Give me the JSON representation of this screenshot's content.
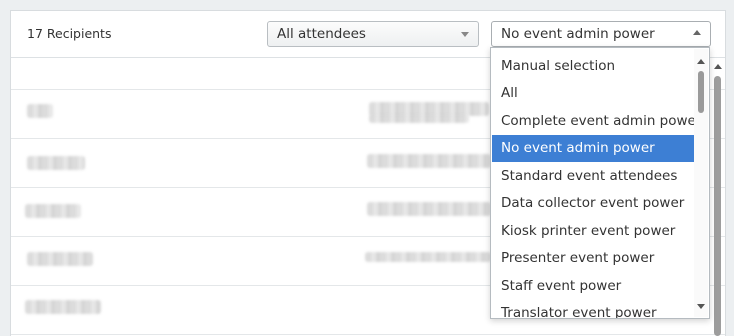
{
  "header": {
    "recipients_count": "17 Recipients"
  },
  "filters": {
    "attendees_select": "All attendees",
    "power_select": "No event admin power"
  },
  "power_dropdown": {
    "options": [
      "Manual selection",
      "All",
      "Complete event admin power",
      "No event admin power",
      "Standard event attendees",
      "Data collector event power",
      "Kiosk printer event power",
      "Presenter event power",
      "Staff event power",
      "Translator event power"
    ],
    "selected": "No event admin power",
    "colors": {
      "selected_bg": "#3d7fd4",
      "selected_text": "#ffffff"
    }
  },
  "table": {
    "note": ""
  }
}
